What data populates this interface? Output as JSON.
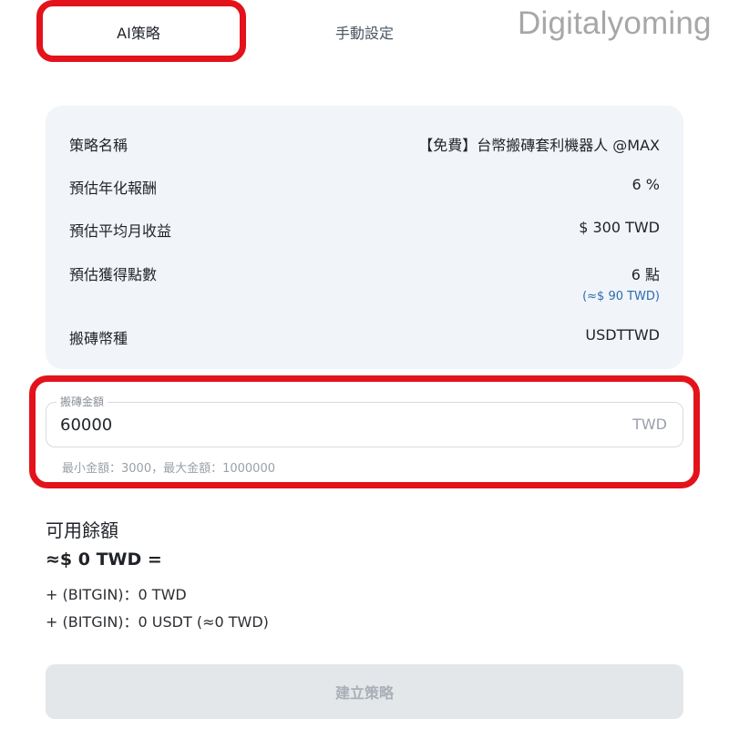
{
  "tabs": {
    "ai_label": "AI策略",
    "manual_label": "手動設定"
  },
  "watermark": "Digitalyoming",
  "strategy_info": {
    "name_label": "策略名稱",
    "name_value": "【免費】台幣搬磚套利機器人 @MAX",
    "annual_return_label": "預估年化報酬",
    "annual_return_value": "6 %",
    "monthly_income_label": "預估平均月收益",
    "monthly_income_value": "$ 300 TWD",
    "points_label": "預估獲得點數",
    "points_value": "6 點",
    "points_sub_value": "(≈$ 90 TWD)",
    "coin_label": "搬磚幣種",
    "coin_value": "USDTTWD"
  },
  "amount_field": {
    "legend": "搬磚金額",
    "value": "60000",
    "unit": "TWD",
    "hint": "最小金額：3000，最大金額：1000000"
  },
  "balance": {
    "title": "可用餘額",
    "total": "≈$ 0 TWD =",
    "lines": [
      "+ (BITGIN)：0 TWD",
      "+ (BITGIN)：0 USDT (≈0 TWD)"
    ]
  },
  "create_button": {
    "label": "建立策略"
  },
  "colors": {
    "highlight_red": "#e3131b",
    "card_bg": "#f1f4f8",
    "link_blue": "#2b6cb0",
    "disabled_button_bg": "#e4e7ea"
  }
}
